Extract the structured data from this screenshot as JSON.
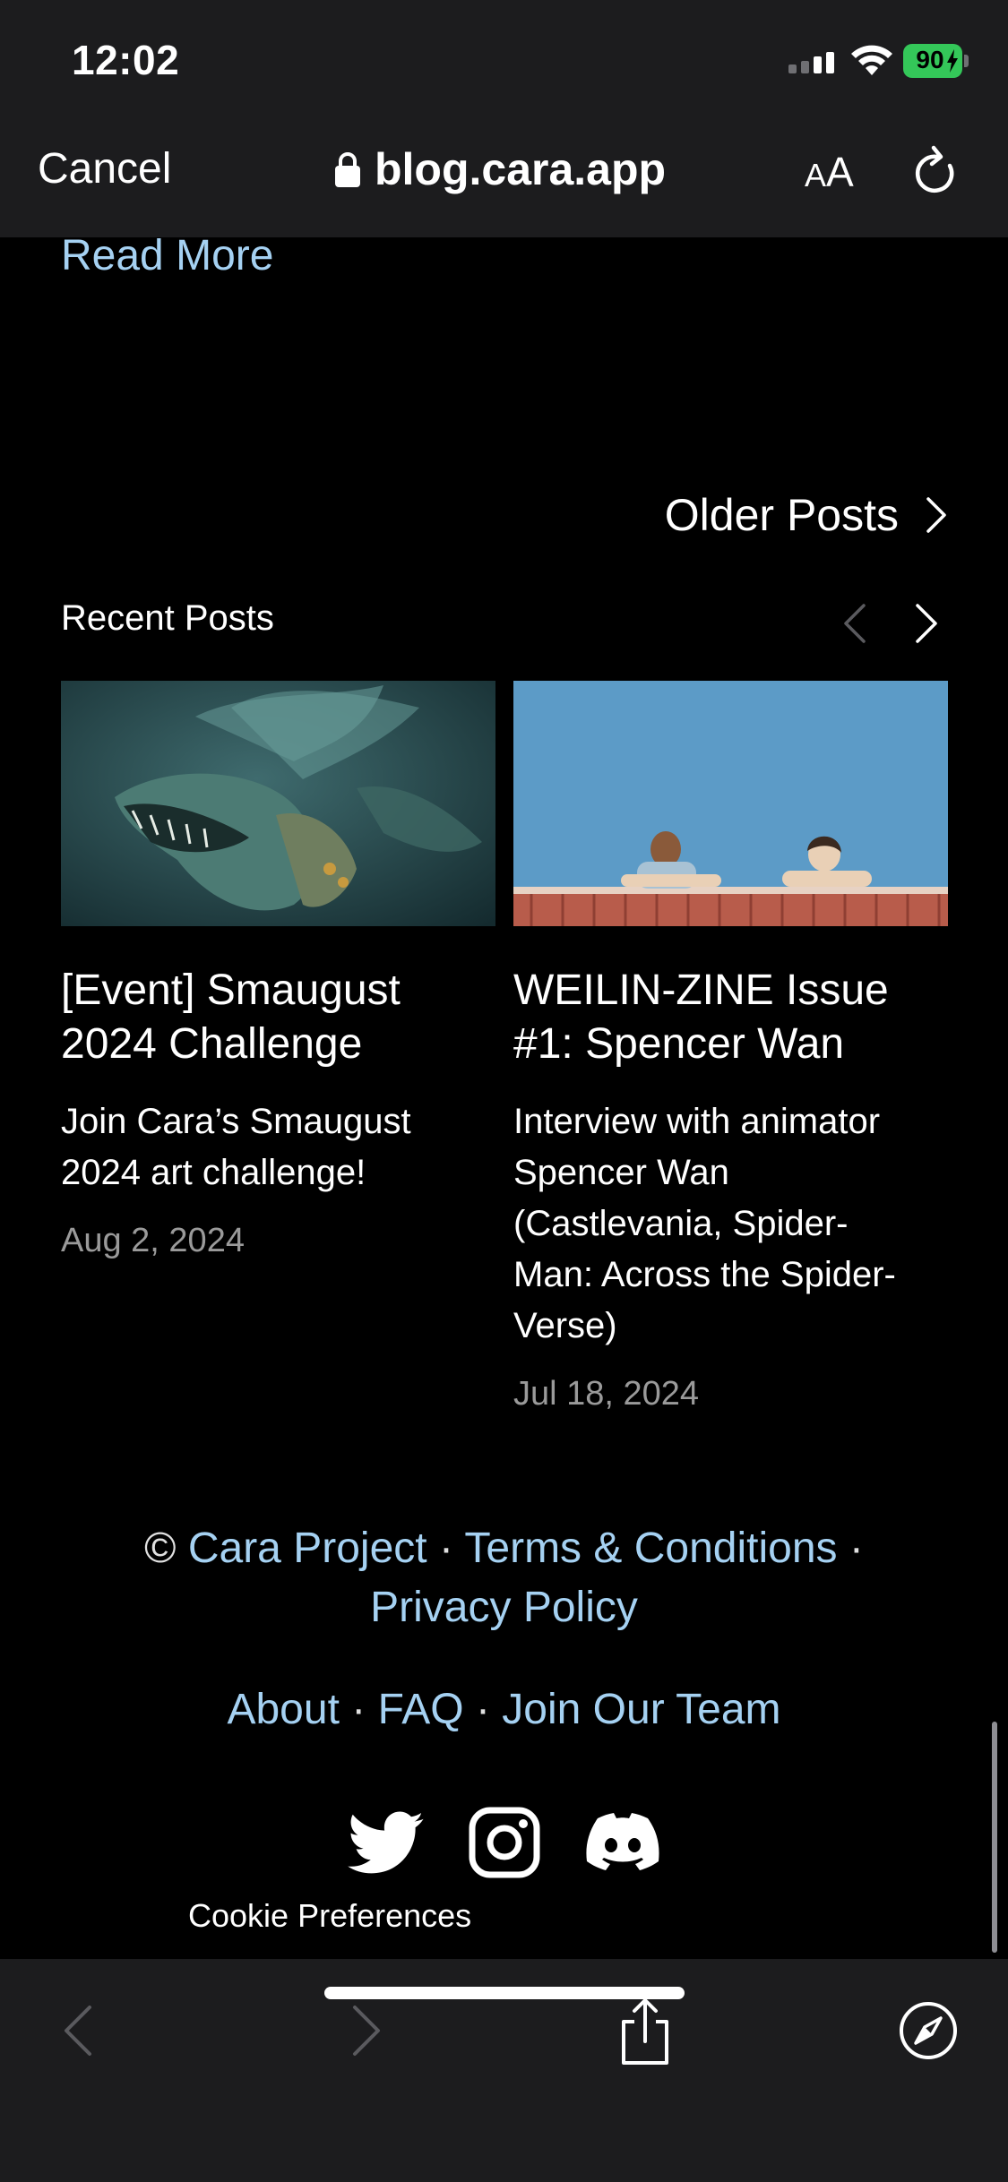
{
  "status_bar": {
    "time": "12:02",
    "battery": "90"
  },
  "browser": {
    "cancel_label": "Cancel",
    "url": "blog.cara.app",
    "text_size_small": "A",
    "text_size_large": "A"
  },
  "content": {
    "read_more": "Read More",
    "older_posts": "Older Posts",
    "recent_posts_title": "Recent Posts",
    "posts": [
      {
        "title_line1": "[Event] Smaugust",
        "title_line2": "2024 Challenge",
        "desc_lines": [
          "Join Cara’s Smaugust",
          "2024 art challenge!"
        ],
        "date": "Aug 2, 2024"
      },
      {
        "title_line1": "WEILIN-ZINE Issue",
        "title_line2": "#1: Spencer Wan",
        "desc_lines": [
          "Interview with animator",
          "Spencer Wan",
          "(Castlevania, Spider-",
          "Man: Across the Spider-",
          "Verse)"
        ],
        "date": "Jul 18, 2024"
      }
    ]
  },
  "footer": {
    "copyright_symbol": "©",
    "cara_project": "Cara Project",
    "terms": "Terms & Conditions",
    "privacy": "Privacy Policy",
    "about": "About",
    "faq": "FAQ",
    "join_team": "Join Our Team",
    "separator": "·",
    "cookie_preferences": "Cookie Preferences"
  },
  "colors": {
    "link": "#a5d1f2",
    "bar_bg": "#1c1c1e",
    "battery": "#34c759"
  }
}
